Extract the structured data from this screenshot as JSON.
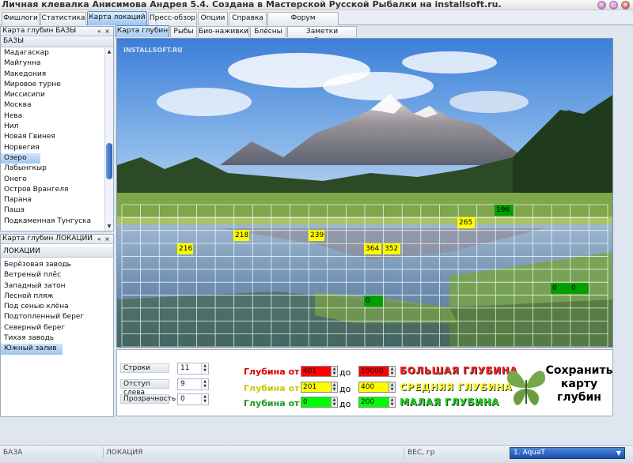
{
  "window": {
    "title": "Личная клевалка Анисимова Андрея 5.4. Создана в Мастерской Русской Рыбалки на installsoft.ru."
  },
  "main_tabs": [
    "Фишлоги",
    "Статистика",
    "Карта локаций",
    "Пресс-обзор",
    "Опции",
    "Справка",
    "Форум InstallSoft.ru"
  ],
  "main_tab_active": "Карта локаций",
  "bases_panel": {
    "title": "Карта глубин БАЗЫ",
    "column": "БАЗЫ",
    "items": [
      "Мадагаскар",
      "Майгунна",
      "Македония",
      "Мировое турне",
      "Миссисипи",
      "Москва",
      "Нева",
      "Нил",
      "Новая Гвинея",
      "Норвегия",
      "Озеро",
      "Лабынгкыр",
      "Онего",
      "Остров Врангеля",
      "Парана",
      "Паша",
      "Подкаменная Тунгуска"
    ],
    "selected": "Озеро"
  },
  "locations_panel": {
    "title": "Карта глубин ЛОКАЦИИ",
    "column": "ЛОКАЦИИ",
    "items": [
      "Берёзовая заводь",
      "Ветреный плёс",
      "Западный затон",
      "Лесной пляж",
      "Под сенью клёна",
      "Подтопленный берег",
      "Северный берег",
      "Тихая заводь",
      "Южный залив"
    ],
    "selected": "Южный залив"
  },
  "sub_tabs": [
    "Карта глубин",
    "Рыбы",
    "Био-наживки",
    "Блёсны",
    "Заметки рыболова"
  ],
  "sub_tab_active": "Карта глубин",
  "watermark": "INSTALLSOFT.RU",
  "depth_marks": [
    {
      "value": "216",
      "type": "yellow"
    },
    {
      "value": "218",
      "type": "yellow"
    },
    {
      "value": "",
      "type": "green"
    },
    {
      "value": "239",
      "type": "yellow"
    },
    {
      "value": "364",
      "type": "yellow"
    },
    {
      "value": "352",
      "type": "yellow"
    },
    {
      "value": "265",
      "type": "yellow"
    },
    {
      "value": "196",
      "type": "green"
    },
    {
      "value": "0",
      "type": "green"
    },
    {
      "value": "0",
      "type": "green"
    },
    {
      "value": "0",
      "type": "green"
    },
    {
      "value": "",
      "type": "blue"
    }
  ],
  "controls": {
    "rows_label": "Строки",
    "rows_value": "11",
    "offset_label": "Отступ слева",
    "offset_value": "9",
    "opacity_label": "Прозрачность",
    "opacity_value": "0"
  },
  "depth_ranges": {
    "from_label": "Глубина от",
    "to_label": "до",
    "big": {
      "from": "401",
      "to": "10000",
      "name": "БОЛЬШАЯ ГЛУБИНА",
      "color": "#ff0000"
    },
    "medium": {
      "from": "201",
      "to": "400",
      "name": "СРЕДНЯЯ ГЛУБИНА",
      "color": "#ffff00"
    },
    "small": {
      "from": "0",
      "to": "200",
      "name": "МАЛАЯ ГЛУБИНА",
      "color": "#00ff00"
    }
  },
  "save_button": "Сохранить карту глубин",
  "status": {
    "base": "БАЗА",
    "location": "ЛОКАЦИЯ",
    "weight": "ВЕС, гр",
    "dropdown": "1. AquaT"
  }
}
